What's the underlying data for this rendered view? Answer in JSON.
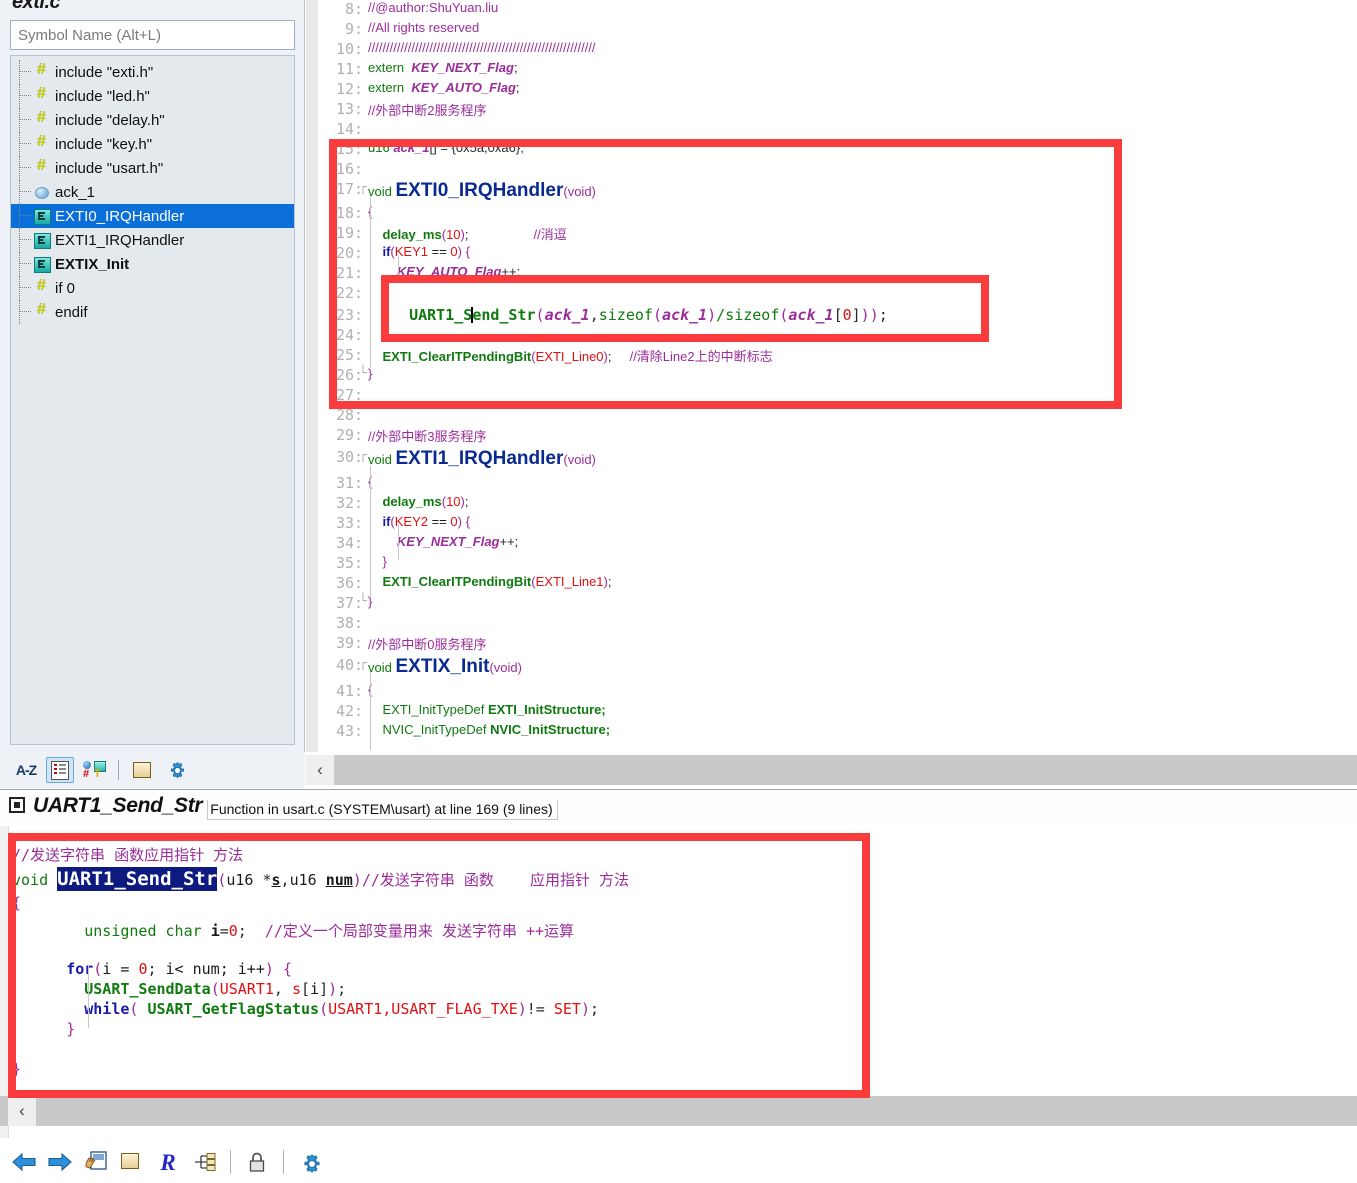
{
  "sidebar": {
    "title": "exti.c",
    "search_placeholder": "Symbol Name (Alt+L)",
    "tree": [
      {
        "icon": "hash-icon",
        "label": "include \"exti.h\"",
        "selected": false,
        "bold": false
      },
      {
        "icon": "hash-icon",
        "label": "include \"led.h\"",
        "selected": false,
        "bold": false
      },
      {
        "icon": "hash-icon",
        "label": "include \"delay.h\"",
        "selected": false,
        "bold": false
      },
      {
        "icon": "hash-icon",
        "label": "include \"key.h\"",
        "selected": false,
        "bold": false
      },
      {
        "icon": "hash-icon",
        "label": "include \"usart.h\"",
        "selected": false,
        "bold": false
      },
      {
        "icon": "variable-icon",
        "label": "ack_1",
        "selected": false,
        "bold": false
      },
      {
        "icon": "function-icon",
        "label": "EXTI0_IRQHandler",
        "selected": true,
        "bold": false
      },
      {
        "icon": "function-icon",
        "label": "EXTI1_IRQHandler",
        "selected": false,
        "bold": false
      },
      {
        "icon": "function-icon",
        "label": "EXTIX_Init",
        "selected": false,
        "bold": true
      },
      {
        "icon": "hash-icon",
        "label": "if 0",
        "selected": false,
        "bold": false
      },
      {
        "icon": "hash-icon",
        "label": "endif",
        "selected": false,
        "bold": false
      }
    ],
    "toolbar": [
      {
        "name": "sort-alphabetical-button",
        "label": "A-Z"
      },
      {
        "name": "outline-list-button",
        "label": ""
      },
      {
        "name": "group-by-type-button",
        "label": ""
      },
      {
        "name": "references-button",
        "label": ""
      },
      {
        "name": "settings-button",
        "label": ""
      }
    ]
  },
  "editor": {
    "lines": [
      {
        "n": "8",
        "fold": "",
        "indent": 0
      },
      {
        "n": "9",
        "fold": "",
        "indent": 0
      },
      {
        "n": "10",
        "fold": "",
        "indent": 0
      },
      {
        "n": "11",
        "fold": "",
        "indent": 0
      },
      {
        "n": "12",
        "fold": "",
        "indent": 0
      },
      {
        "n": "13",
        "fold": "",
        "indent": 0
      },
      {
        "n": "14",
        "fold": "",
        "indent": 0
      },
      {
        "n": "15",
        "fold": "",
        "indent": 0
      },
      {
        "n": "16",
        "fold": "",
        "indent": 0
      },
      {
        "n": "17",
        "fold": "┌",
        "indent": 0
      },
      {
        "n": "18",
        "fold": "",
        "indent": 0
      },
      {
        "n": "19",
        "fold": "",
        "indent": 0
      },
      {
        "n": "20",
        "fold": "",
        "indent": 0
      },
      {
        "n": "21",
        "fold": "",
        "indent": 0
      },
      {
        "n": "22",
        "fold": "",
        "indent": 0
      },
      {
        "n": "23",
        "fold": "",
        "indent": 0
      },
      {
        "n": "24",
        "fold": "",
        "indent": 0
      },
      {
        "n": "25",
        "fold": "",
        "indent": 0
      },
      {
        "n": "26",
        "fold": "└",
        "indent": 0
      },
      {
        "n": "27",
        "fold": "",
        "indent": 0
      },
      {
        "n": "28",
        "fold": "",
        "indent": 0
      },
      {
        "n": "29",
        "fold": "",
        "indent": 0
      },
      {
        "n": "30",
        "fold": "┌",
        "indent": 0
      },
      {
        "n": "31",
        "fold": "",
        "indent": 0
      },
      {
        "n": "32",
        "fold": "",
        "indent": 0
      },
      {
        "n": "33",
        "fold": "",
        "indent": 0
      },
      {
        "n": "34",
        "fold": "",
        "indent": 0
      },
      {
        "n": "35",
        "fold": "",
        "indent": 0
      },
      {
        "n": "36",
        "fold": "",
        "indent": 0
      },
      {
        "n": "37",
        "fold": "└",
        "indent": 0
      },
      {
        "n": "38",
        "fold": "",
        "indent": 0
      },
      {
        "n": "39",
        "fold": "",
        "indent": 0
      },
      {
        "n": "40",
        "fold": "┌",
        "indent": 0
      },
      {
        "n": "41",
        "fold": "",
        "indent": 0
      },
      {
        "n": "42",
        "fold": "",
        "indent": 0
      },
      {
        "n": "43",
        "fold": "",
        "indent": 0
      }
    ],
    "code": {
      "l8": "//@author:ShuYuan.liu",
      "l9": "//All rights reserved",
      "l10": "///////////////////////////////////////////////////////////////",
      "l11_kw": "extern",
      "l11_var": "KEY_NEXT_Flag",
      "l12_kw": "extern",
      "l12_var": "KEY_AUTO_Flag",
      "l13": "//外部中断2服务程序",
      "l15_type": "u16",
      "l15_name": "ack_1",
      "l15_rest": "[] = {0x5a,0xa6};",
      "l17_kw": "void",
      "l17_fn": "EXTI0_IRQHandler",
      "l17_args": "(void)",
      "l18": "{",
      "l19_fn": "delay_ms",
      "l19_num": "10",
      "l19_cmt": "//消逗",
      "l20_kw": "if",
      "l20_mac": "KEY1",
      "l20_num": "0",
      "l21_var": "KEY_AUTO_Flag",
      "l23_fn": "UART1_Send_Str",
      "l23_arg1": "ack_1",
      "l23_sizeof": "sizeof",
      "l24": "}",
      "l25_fn": "EXTI_ClearITPendingBit",
      "l25_arg": "EXTI_Line0",
      "l25_cmt": "//清除Line2上的中断标志",
      "l26": "}",
      "l29": "//外部中断3服务程序",
      "l30_kw": "void",
      "l30_fn": "EXTI1_IRQHandler",
      "l30_args": "(void)",
      "l31": "{",
      "l32_fn": "delay_ms",
      "l32_num": "10",
      "l33_kw": "if",
      "l33_mac": "KEY2",
      "l33_num": "0",
      "l34_var": "KEY_NEXT_Flag",
      "l35": "}",
      "l36_fn": "EXTI_ClearITPendingBit",
      "l36_arg": "EXTI_Line1",
      "l37": "}",
      "l39": "//外部中断0服务程序",
      "l40_kw": "void",
      "l40_fn": "EXTIX_Init",
      "l40_args": "(void)",
      "l41": "{",
      "l42_type": "EXTI_InitTypeDef",
      "l42_name": "EXTI_InitStructure;",
      "l43_type": "NVIC_InitTypeDef",
      "l43_name": "NVIC_InitStructure;"
    },
    "scroll_left_label": "‹"
  },
  "bottom_panel": {
    "icon": "definition-icon",
    "title": "UART1_Send_Str",
    "subtitle": "Function in usart.c (SYSTEM\\usart) at line 169 (9 lines)",
    "code": {
      "b1_cmt": "//发送字符串 函数应用指针 方法",
      "b2_kw": "void",
      "b2_name": "UART1_Send_Str",
      "b2_p1type": "u16",
      "b2_p1": "*s",
      "b2_p2type": "u16",
      "b2_p2": "num",
      "b2_cmt": "//发送字符串 函数    应用指针 方法",
      "b3": "{",
      "b4_kw": "unsigned char",
      "b4_var": "i=0;",
      "b4_cmt": "//定义一个局部变量用来 发送字符串 ++运算",
      "b6_kw": "for",
      "b6_rest": "(i = 0; i< num; i++) {",
      "b7_fn": "USART_SendData",
      "b7_arg": "USART1, s[i]",
      "b8_kw": "while",
      "b8_fn": "USART_GetFlagStatus",
      "b8_arg": "USART1,USART_FLAG_TXE",
      "b8_rest": "!= SET);",
      "b9": "}",
      "b11": "}"
    },
    "scroll_left_label": "‹",
    "toolbar": [
      {
        "name": "navigate-back-button"
      },
      {
        "name": "navigate-forward-button"
      },
      {
        "name": "open-definition-button"
      },
      {
        "name": "browse-references-button"
      },
      {
        "name": "rebuild-browse-info-button"
      },
      {
        "name": "call-graph-button"
      },
      {
        "name": "lock-button"
      },
      {
        "name": "settings-button"
      }
    ]
  },
  "annotations": {
    "highlight_color": "#fa3c3c",
    "boxes": [
      {
        "name": "exti0-handler-highlight"
      },
      {
        "name": "uart1-send-str-call-highlight"
      },
      {
        "name": "uart1-send-str-definition-highlight"
      }
    ]
  }
}
